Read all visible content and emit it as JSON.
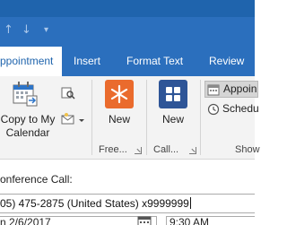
{
  "quick_access": {
    "up_icon": "arrow-up-icon",
    "down_icon": "arrow-down-icon",
    "customize_icon": "customize-qat-icon"
  },
  "tabs": [
    {
      "label": "ppointment",
      "active": true
    },
    {
      "label": "Insert",
      "active": false
    },
    {
      "label": "Format Text",
      "active": false
    },
    {
      "label": "Review",
      "active": false
    }
  ],
  "ribbon": {
    "actions_group": {
      "copy_label_line1": "Copy to My",
      "copy_label_line2": "Calendar",
      "forward_icon": "forward-icon",
      "lookup_icon": "lookup-icon"
    },
    "free_group": {
      "button_label": "New",
      "group_label": "Free...",
      "icon": "new-meeting-icon"
    },
    "call_group": {
      "button_label": "New",
      "group_label": "Call...",
      "icon": "new-call-icon"
    },
    "show_group": {
      "items": [
        {
          "label": "Appoin",
          "selected": true,
          "icon": "appointment-icon"
        },
        {
          "label": "Schedu",
          "selected": false,
          "icon": "scheduling-icon"
        }
      ],
      "group_label": "Show"
    }
  },
  "form": {
    "subject_label": "onference Call:",
    "location_value": "05) 475-2875 (United States) x9999999",
    "start_date": "n 2/6/2017",
    "start_time": "9:30 AM"
  },
  "colors": {
    "title_bar": "#1f64ad",
    "ribbon_tabs": "#2b6fbd",
    "orange_button": "#ea6b2d",
    "blue_button": "#2e5597"
  }
}
